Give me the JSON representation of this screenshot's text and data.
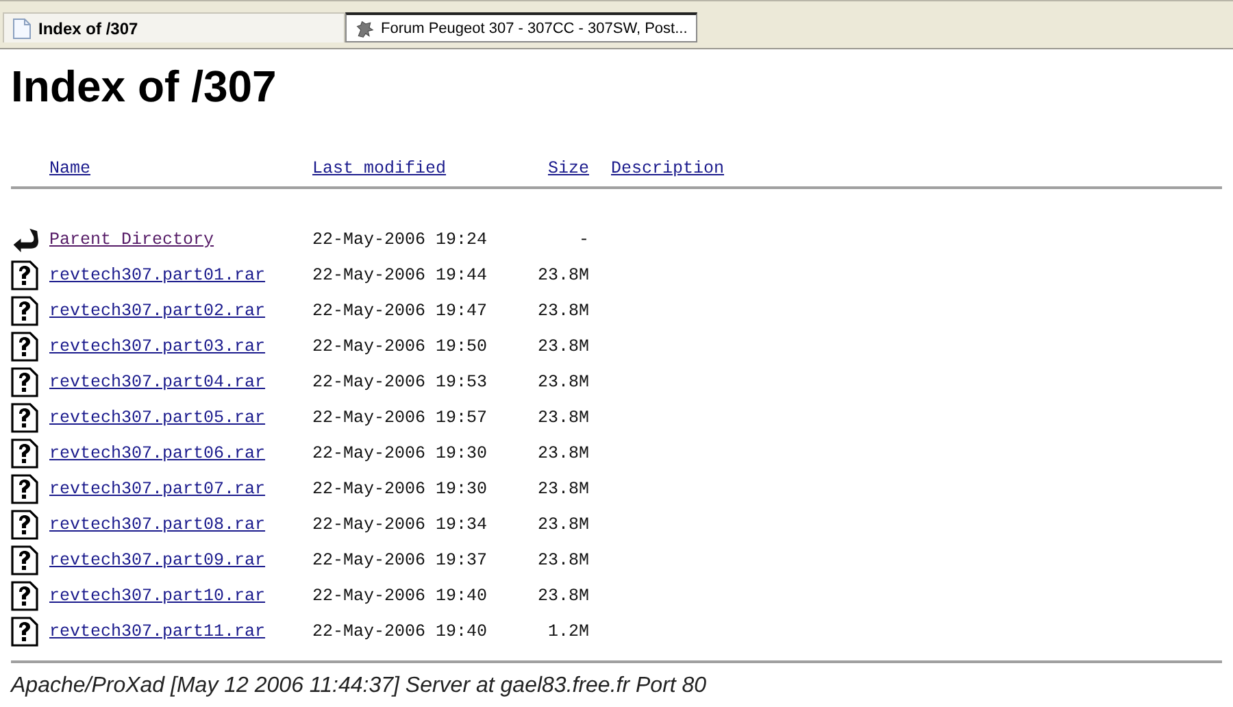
{
  "tabs": [
    {
      "title": "Index of /307",
      "kind": "page",
      "selected": true
    },
    {
      "title": "Forum Peugeot 307 - 307CC - 307SW, Post...",
      "kind": "site",
      "selected": false
    }
  ],
  "heading": "Index of /307",
  "columns": [
    "Name",
    "Last modified",
    "Size",
    "Description"
  ],
  "rows": [
    {
      "name": "Parent Directory",
      "kind": "parent",
      "visited": true,
      "modified": "22-May-2006 19:24",
      "size": "-"
    },
    {
      "name": "revtech307.part01.rar",
      "kind": "file",
      "visited": false,
      "modified": "22-May-2006 19:44",
      "size": "23.8M"
    },
    {
      "name": "revtech307.part02.rar",
      "kind": "file",
      "visited": false,
      "modified": "22-May-2006 19:47",
      "size": "23.8M"
    },
    {
      "name": "revtech307.part03.rar",
      "kind": "file",
      "visited": false,
      "modified": "22-May-2006 19:50",
      "size": "23.8M"
    },
    {
      "name": "revtech307.part04.rar",
      "kind": "file",
      "visited": false,
      "modified": "22-May-2006 19:53",
      "size": "23.8M"
    },
    {
      "name": "revtech307.part05.rar",
      "kind": "file",
      "visited": false,
      "modified": "22-May-2006 19:57",
      "size": "23.8M"
    },
    {
      "name": "revtech307.part06.rar",
      "kind": "file",
      "visited": false,
      "modified": "22-May-2006 19:30",
      "size": "23.8M"
    },
    {
      "name": "revtech307.part07.rar",
      "kind": "file",
      "visited": false,
      "modified": "22-May-2006 19:30",
      "size": "23.8M"
    },
    {
      "name": "revtech307.part08.rar",
      "kind": "file",
      "visited": false,
      "modified": "22-May-2006 19:34",
      "size": "23.8M"
    },
    {
      "name": "revtech307.part09.rar",
      "kind": "file",
      "visited": false,
      "modified": "22-May-2006 19:37",
      "size": "23.8M"
    },
    {
      "name": "revtech307.part10.rar",
      "kind": "file",
      "visited": false,
      "modified": "22-May-2006 19:40",
      "size": "23.8M"
    },
    {
      "name": "revtech307.part11.rar",
      "kind": "file",
      "visited": false,
      "modified": "22-May-2006 19:40",
      "size": "1.2M"
    }
  ],
  "footer": "Apache/ProXad [May 12 2006 11:44:37] Server at gael83.free.fr Port 80"
}
